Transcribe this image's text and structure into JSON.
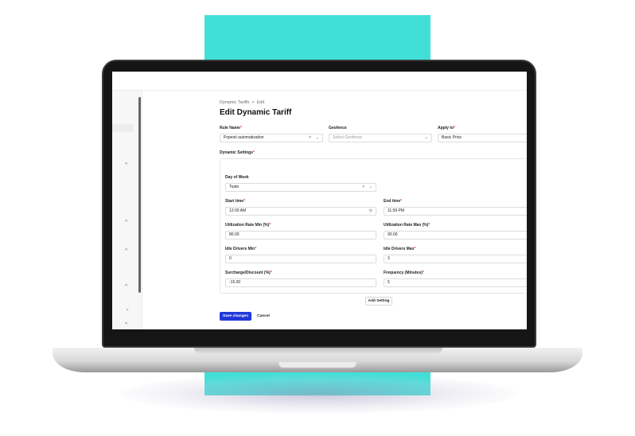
{
  "breadcrumb": {
    "parent": "Dynamic Tariffs",
    "separator": ">",
    "current": "Edit"
  },
  "page_title": "Edit Dynamic Tariff",
  "form": {
    "rule_name": {
      "label": "Rule Name",
      "required_mark": "*",
      "value": "Popesti automatization"
    },
    "geofence": {
      "label": "Geofence",
      "placeholder": "Select Geofence"
    },
    "apply_to": {
      "label": "Apply to",
      "required_mark": "*",
      "value": "Basic Price"
    },
    "dynamic_settings": {
      "label": "Dynamic Settings",
      "required_mark": "*"
    }
  },
  "setting": {
    "day_of_week": {
      "label": "Day of Week",
      "value": "Toate"
    },
    "start_time": {
      "label": "Start time",
      "required_mark": "*",
      "value": "12:00 AM"
    },
    "end_time": {
      "label": "End time",
      "required_mark": "*",
      "value": "11:59 PM"
    },
    "util_min": {
      "label": "Utilization Rate Min (%)",
      "required_mark": "*",
      "value": "80.00"
    },
    "util_max": {
      "label": "Utilization Rate Max (%)",
      "required_mark": "*",
      "value": "90.00"
    },
    "idle_min": {
      "label": "Idle Drivers Min",
      "required_mark": "*",
      "value": "0"
    },
    "idle_max": {
      "label": "Idle Drivers Max",
      "required_mark": "*",
      "value": "3"
    },
    "surcharge": {
      "label": "Surcharge/Discount (%)",
      "required_mark": "*",
      "value": "-15.00"
    },
    "frequency": {
      "label": "Frequency (Minutes)",
      "required_mark": "*",
      "value": "5"
    }
  },
  "buttons": {
    "add_setting": "Add Setting",
    "save": "Save changes",
    "cancel": "Cancel"
  },
  "icons": {
    "clear": "×",
    "chevron": "⌄",
    "clock": "◷",
    "sidebar_chevron": "^",
    "sidebar_chevron_down": "⌄"
  },
  "colors": {
    "accent_teal": "#40e0d8",
    "primary_button": "#2238d8"
  }
}
